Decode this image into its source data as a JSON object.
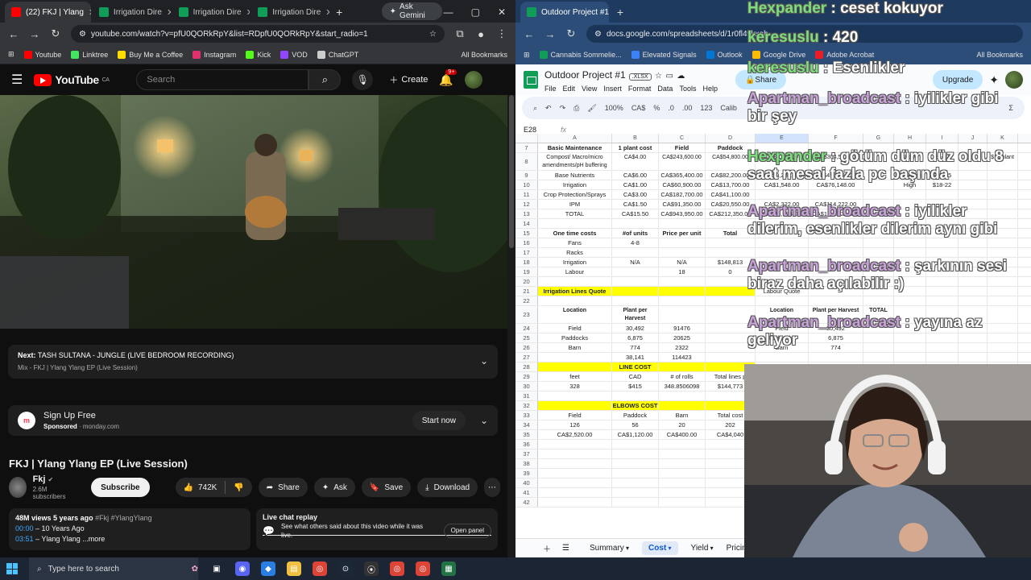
{
  "left_browser": {
    "tabs": [
      {
        "label": "(22) FKJ | Ylang",
        "active": true,
        "favicon_color": "#ff0000"
      },
      {
        "label": "Irrigation Dire",
        "active": false,
        "favicon_color": "#0f9d58"
      },
      {
        "label": "Irrigation Dire",
        "active": false,
        "favicon_color": "#0f9d58"
      },
      {
        "label": "Irrigation Dire",
        "active": false,
        "favicon_color": "#0f9d58"
      }
    ],
    "ask_gemini": "Ask Gemini",
    "url": "youtube.com/watch?v=pfU0QORkRpY&list=RDpfU0QORkRpY&start_radio=1",
    "bookmarks": [
      {
        "label": "Youtube",
        "color": "#ff0000"
      },
      {
        "label": "Linktree",
        "color": "#43e660"
      },
      {
        "label": "Buy Me a Coffee",
        "color": "#ffdd00"
      },
      {
        "label": "Instagram",
        "color": "#e1306c"
      },
      {
        "label": "Kick",
        "color": "#53fc18"
      },
      {
        "label": "VOD",
        "color": "#9146ff"
      },
      {
        "label": "ChatGPT",
        "color": "#cccccc"
      }
    ],
    "all_bookmarks": "All Bookmarks"
  },
  "youtube": {
    "logo_text": "YouTube",
    "region": "CA",
    "search_placeholder": "Search",
    "create_label": "Create",
    "notif_count": "9+",
    "up_next_prefix": "Next:",
    "up_next_title": "TASH SULTANA - JUNGLE (LIVE BEDROOM RECORDING)",
    "up_next_mix": "Mix - FKJ  |  Ylang Ylang EP (Live Session)",
    "ad_title": "Sign Up Free",
    "ad_sponsored": "Sponsored",
    "ad_domain": "monday.com",
    "ad_cta": "Start now",
    "video_title": "FKJ | Ylang Ylang EP (Live Session)",
    "channel_name": "Fkj",
    "channel_subs": "2.6M subscribers",
    "subscribe_label": "Subscribe",
    "likes": "742K",
    "share_label": "Share",
    "ask_label": "Ask",
    "save_label": "Save",
    "download_label": "Download",
    "desc_views": "48M views",
    "desc_age": "5 years ago",
    "desc_tags": "#Fkj #YlangYlang",
    "desc_line2_ts": "00:00",
    "desc_line2_text": " – 10 Years Ago",
    "desc_line3_ts": "03:51",
    "desc_line3_text": " – Ylang Ylang ...more",
    "live_chat_title": "Live chat replay",
    "live_chat_text": "See what others said about this video while it was live.",
    "open_panel": "Open panel"
  },
  "right_browser": {
    "tab_label": "Outdoor Project #1.xlsx - Goog",
    "url": "docs.google.com/spreadsheets/d/1r0fl4vkxob...",
    "bookmarks": [
      {
        "label": "Cannabis Sommelie...",
        "color": "#0f9d58"
      },
      {
        "label": "Elevated Signals",
        "color": "#3b82f6"
      },
      {
        "label": "Outlook",
        "color": "#0078d4"
      },
      {
        "label": "Google Drive",
        "color": "#fbbc04"
      },
      {
        "label": "Adobe Acrobat",
        "color": "#ec1c24"
      }
    ],
    "all_bookmarks": "All Bookmarks"
  },
  "sheets": {
    "title": "Outdoor Project #1",
    "file_ext": ".XLSX",
    "menus": [
      "File",
      "Edit",
      "View",
      "Insert",
      "Format",
      "Data",
      "Tools",
      "Help"
    ],
    "share_label": "Share",
    "upgrade_label": "Upgrade",
    "zoom": "100%",
    "currency": "CA$",
    "percent": "%",
    "decimals": ".0",
    "dec2": ".00",
    "numfmt": "123",
    "font_hint": "Calib",
    "cell_ref": "E28",
    "columns": [
      "A",
      "B",
      "C",
      "D",
      "E",
      "F",
      "G",
      "H",
      "I",
      "J",
      "K"
    ],
    "rows": [
      {
        "n": "7",
        "cells": [
          "Basic Maintenance",
          "1 plant cost",
          "Field",
          "Paddock",
          "",
          "",
          "",
          "",
          "",
          "",
          ""
        ],
        "bold": true
      },
      {
        "n": "8",
        "cells": [
          "Compost/ Macro/micro amendments/pH buffering",
          "CA$4.00",
          "CA$243,600.00",
          "CA$54,800.00",
          "CA$6,192.00",
          "CA$304,592.00",
          "",
          "Low",
          "$8-10",
          "",
          "$16/plant"
        ],
        "tall": true
      },
      {
        "n": "9",
        "cells": [
          "Base Nutrients",
          "CA$6.00",
          "CA$365,400.00",
          "CA$82,200.00",
          "CA$9,288.00",
          "CA$456,888.00",
          "",
          "Mid-Range",
          "$12-15",
          "",
          ""
        ]
      },
      {
        "n": "10",
        "cells": [
          "Irrigation",
          "CA$1.00",
          "CA$60,900.00",
          "CA$13,700.00",
          "CA$1,548.00",
          "CA$76,148.00",
          "",
          "High",
          "$18-22",
          "",
          ""
        ]
      },
      {
        "n": "11",
        "cells": [
          "Crop Protection/Sprays",
          "CA$3.00",
          "CA$182,700.00",
          "CA$41,100.00",
          "",
          "",
          "",
          "",
          "",
          "",
          ""
        ]
      },
      {
        "n": "12",
        "cells": [
          "IPM",
          "CA$1.50",
          "CA$91,350.00",
          "CA$20,550.00",
          "CA$2,322.00",
          "CA$114,222.00",
          "",
          "",
          "",
          "",
          ""
        ]
      },
      {
        "n": "13",
        "cells": [
          "TOTAL",
          "CA$15.50",
          "CA$943,950.00",
          "CA$212,350.00",
          "CA$23,994.00",
          "CA$1,180,294.00",
          "",
          "",
          "",
          "",
          ""
        ]
      },
      {
        "n": "14",
        "cells": [
          "",
          "",
          "",
          "",
          "",
          "",
          "",
          "",
          "",
          "",
          ""
        ]
      },
      {
        "n": "15",
        "cells": [
          "One time costs",
          "#of units",
          "Price per unit",
          "Total",
          "",
          "",
          "",
          "",
          "",
          "",
          ""
        ],
        "bold": true
      },
      {
        "n": "16",
        "cells": [
          "Fans",
          "4-8",
          "",
          "",
          "",
          "",
          "",
          "",
          "",
          "",
          ""
        ]
      },
      {
        "n": "17",
        "cells": [
          "Racks",
          "",
          "",
          "",
          "",
          "",
          "",
          "",
          "",
          "",
          ""
        ]
      },
      {
        "n": "18",
        "cells": [
          "Irrigation",
          "N/A",
          "N/A",
          "$148,813",
          "",
          "",
          "",
          "",
          "",
          "",
          ""
        ]
      },
      {
        "n": "19",
        "cells": [
          "Labour",
          "",
          "18",
          "0",
          "",
          "",
          "",
          "",
          "",
          "",
          ""
        ]
      },
      {
        "n": "20",
        "cells": [
          "",
          "",
          "",
          "",
          "",
          "",
          "",
          "",
          "",
          "",
          ""
        ]
      },
      {
        "n": "21",
        "cells": [
          "Irrigation Lines Quote",
          "",
          "",
          "",
          "Labour Quote",
          "",
          "",
          "",
          "",
          "",
          ""
        ],
        "yellow": true
      },
      {
        "n": "22",
        "cells": [
          "",
          "",
          "",
          "",
          "",
          "",
          "",
          "",
          "",
          "",
          ""
        ]
      },
      {
        "n": "23",
        "cells": [
          "Location",
          "Plant per Harvest",
          "",
          "",
          "Location",
          "Plant per Harvest",
          "TOTAL",
          "",
          "",
          "",
          ""
        ],
        "bold": true,
        "tall": true
      },
      {
        "n": "24",
        "cells": [
          "Field",
          "30,492",
          "91476",
          "",
          "Field",
          "30,492",
          "",
          "",
          "",
          "",
          ""
        ]
      },
      {
        "n": "25",
        "cells": [
          "Paddocks",
          "6,875",
          "20625",
          "",
          "Paddocks",
          "6,875",
          "",
          "",
          "",
          "",
          ""
        ]
      },
      {
        "n": "26",
        "cells": [
          "Barn",
          "774",
          "2322",
          "",
          "Barn",
          "774",
          "",
          "",
          "",
          "",
          ""
        ]
      },
      {
        "n": "27",
        "cells": [
          "",
          "38,141",
          "114423",
          "",
          "",
          "",
          "",
          "",
          "",
          "",
          ""
        ]
      },
      {
        "n": "28",
        "cells": [
          "",
          "LINE COST",
          "",
          "",
          "",
          "",
          "",
          "",
          "",
          "",
          ""
        ],
        "yellowB": true
      },
      {
        "n": "29",
        "cells": [
          "feet",
          "CAD",
          "# of rolls",
          "Total lines p",
          "",
          "",
          "",
          "",
          "",
          "",
          ""
        ]
      },
      {
        "n": "30",
        "cells": [
          "328",
          "$415",
          "348.8506098",
          "$144,773",
          "",
          "",
          "",
          "",
          "",
          "",
          ""
        ]
      },
      {
        "n": "31",
        "cells": [
          "",
          "",
          "",
          "",
          "",
          "",
          "",
          "",
          "",
          "",
          ""
        ]
      },
      {
        "n": "32",
        "cells": [
          "",
          "ELBOWS COST",
          "",
          "",
          "",
          "",
          "",
          "",
          "",
          "",
          ""
        ],
        "yellowB": true
      },
      {
        "n": "33",
        "cells": [
          "Field",
          "Paddock",
          "Barn",
          "Total cost",
          "",
          "",
          "",
          "",
          "",
          "",
          ""
        ]
      },
      {
        "n": "34",
        "cells": [
          "126",
          "56",
          "20",
          "202",
          "",
          "",
          "",
          "",
          "",
          "",
          ""
        ]
      },
      {
        "n": "35",
        "cells": [
          "CA$2,520.00",
          "CA$1,120.00",
          "CA$400.00",
          "CA$4,040",
          "",
          "",
          "",
          "",
          "",
          "",
          ""
        ]
      },
      {
        "n": "36",
        "cells": [
          "",
          "",
          "",
          "",
          "",
          "",
          "",
          "",
          "",
          "",
          ""
        ]
      },
      {
        "n": "37",
        "cells": [
          "",
          "",
          "",
          "",
          "",
          "",
          "",
          "",
          "",
          "",
          ""
        ]
      },
      {
        "n": "38",
        "cells": [
          "",
          "",
          "",
          "",
          "",
          "",
          "",
          "",
          "",
          "",
          ""
        ]
      },
      {
        "n": "39",
        "cells": [
          "",
          "",
          "",
          "",
          "",
          "",
          "",
          "",
          "",
          "",
          ""
        ]
      },
      {
        "n": "40",
        "cells": [
          "",
          "",
          "",
          "",
          "",
          "",
          "",
          "",
          "",
          "",
          ""
        ]
      },
      {
        "n": "41",
        "cells": [
          "",
          "",
          "",
          "",
          "",
          "",
          "",
          "",
          "",
          "",
          ""
        ]
      },
      {
        "n": "42",
        "cells": [
          "",
          "",
          "",
          "",
          "",
          "",
          "",
          "",
          "",
          "",
          ""
        ]
      }
    ],
    "sheet_tabs": [
      "Summary",
      "Cost",
      "Yield",
      "Pricing"
    ],
    "active_sheet": "Cost"
  },
  "chat_overlay": [
    {
      "user": "Hexpander",
      "text": " : ceset kokuyor",
      "green": true
    },
    {
      "user": "keresuslu",
      "text": " : 420",
      "green": true
    },
    {
      "user": "keresuslu",
      "text": " : Esenlikler",
      "green": true
    },
    {
      "user": "Apartman_broadcast",
      "text": " : iyilikler gibi",
      "cont": "bir şey",
      "green": false
    },
    {
      "user": "Hexpander",
      "text": " : götüm düm düz oldu 8",
      "cont": "saat mesai fazla pc başında",
      "green": true
    },
    {
      "user": "Apartman_broadcast",
      "text": " : iyilikler",
      "cont": "dilerim, esenlikler dilerim aynı gibi",
      "green": false
    },
    {
      "user": "Apartman_broadcast",
      "text": " : şarkının sesi",
      "cont": "biraz daha açılabilir :)",
      "green": false
    },
    {
      "user": "Apartman_broadcast",
      "text": " : yayına az",
      "cont": "geliyor",
      "green": false
    }
  ],
  "taskbar": {
    "search_placeholder": "Type here to search"
  }
}
